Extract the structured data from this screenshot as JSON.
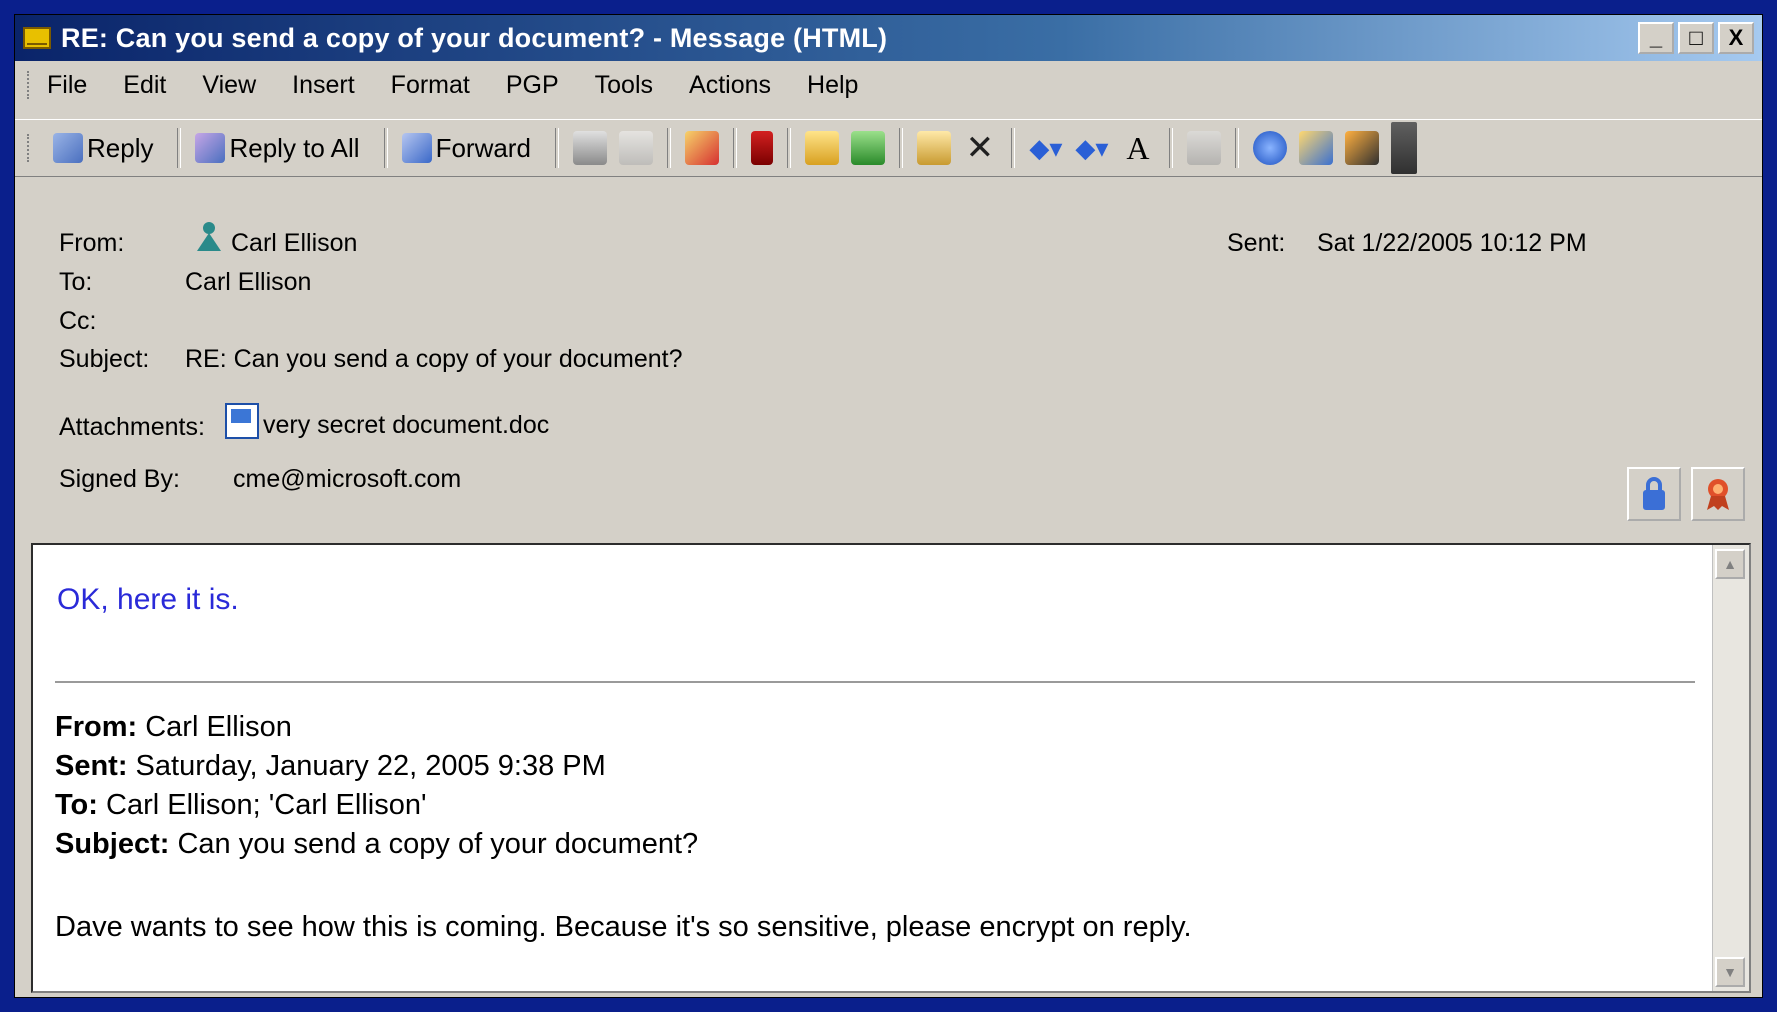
{
  "window": {
    "title": "RE: Can you send a copy of your document? - Message (HTML)",
    "controls": [
      "_",
      "□",
      "X"
    ]
  },
  "menu": [
    "File",
    "Edit",
    "View",
    "Insert",
    "Format",
    "PGP",
    "Tools",
    "Actions",
    "Help"
  ],
  "toolbar": {
    "reply": "Reply",
    "reply_all": "Reply to All",
    "forward": "Forward",
    "icons": [
      "print-icon",
      "copy-icon",
      "categorize-icon",
      "flag-icon",
      "open-folder-icon",
      "save-icon",
      "move-icon",
      "delete-icon",
      "previous-icon",
      "next-icon",
      "font-size-icon",
      "address-book-icon",
      "help-icon",
      "pgp-encrypt-icon",
      "pgp-sign-icon",
      "toolbar-options-icon"
    ]
  },
  "header": {
    "from_label": "From:",
    "from_value": "Carl Ellison",
    "sent_label": "Sent:",
    "sent_value": "Sat 1/22/2005 10:12 PM",
    "to_label": "To:",
    "to_value": "Carl Ellison",
    "cc_label": "Cc:",
    "subject_label": "Subject:",
    "subject_value": "RE: Can you send a copy of your document?",
    "attachments_label": "Attachments:",
    "attachment_name": "very secret document.doc",
    "signed_label": "Signed By:",
    "signed_value": "cme@microsoft.com"
  },
  "body": {
    "reply_text": "OK, here it is.",
    "orig_from_label": "From:",
    "orig_from": " Carl Ellison",
    "orig_sent_label": "Sent:",
    "orig_sent": " Saturday, January 22, 2005 9:38 PM",
    "orig_to_label": "To:",
    "orig_to": " Carl Ellison; 'Carl Ellison'",
    "orig_subject_label": "Subject:",
    "orig_subject": " Can you send a copy of your document?",
    "orig_text": "Dave wants to see how this is coming. Because it's so sensitive, please encrypt on reply."
  },
  "colors": {
    "background": "#0a1f8c",
    "reply_text": "#2a2ad8",
    "title_bar": "#0a246a"
  }
}
